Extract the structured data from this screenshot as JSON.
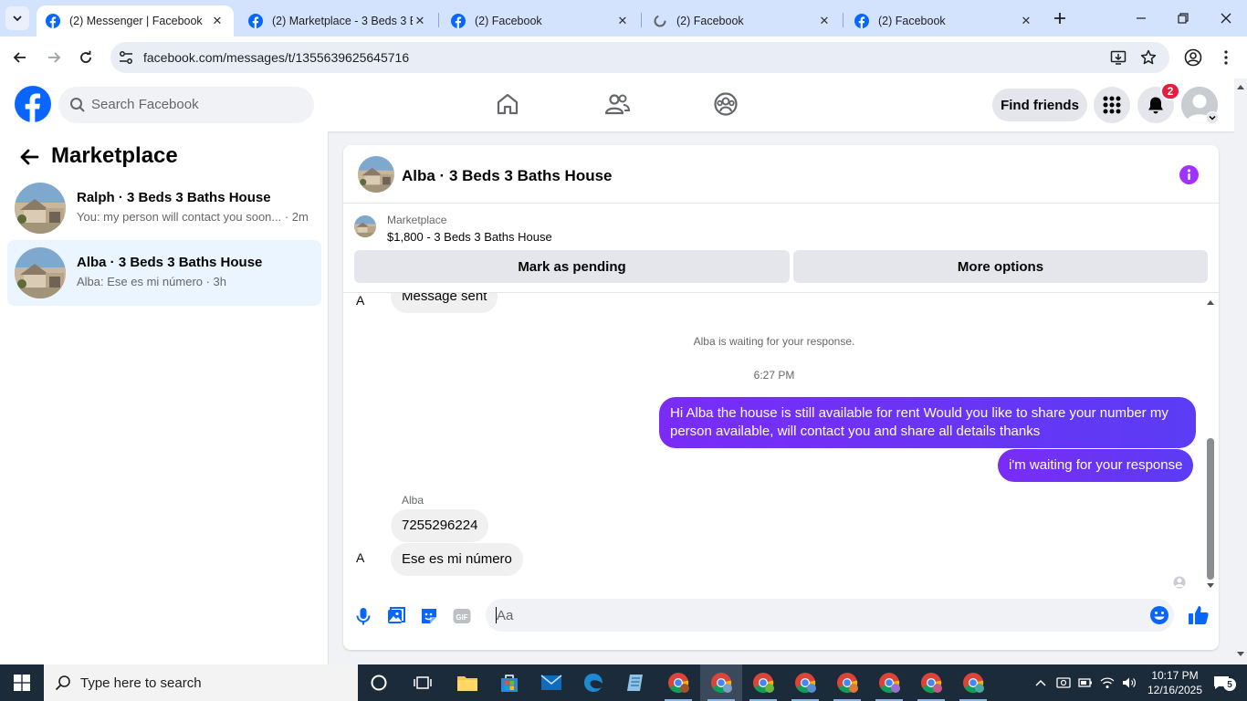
{
  "browser": {
    "tabs": [
      {
        "title": "(2) Messenger | Facebook",
        "active": true
      },
      {
        "title": "(2) Marketplace - 3 Beds 3 B",
        "active": false
      },
      {
        "title": "(2) Facebook",
        "active": false
      },
      {
        "title": "(2) Facebook",
        "active": false
      },
      {
        "title": "(2) Facebook",
        "active": false
      }
    ],
    "url": "facebook.com/messages/t/1355639625645716"
  },
  "fb": {
    "search_placeholder": "Search Facebook",
    "find_friends": "Find friends",
    "notification_count": "2",
    "accent_color": "#0866ff"
  },
  "sidebar": {
    "title": "Marketplace",
    "conversations": [
      {
        "name": "Ralph · 3 Beds 3 Baths House",
        "preview": "You: my person will contact you soon... · 2m",
        "active": false
      },
      {
        "name": "Alba · 3 Beds 3 Baths House",
        "preview": "Alba: Ese es mi número · 3h",
        "active": true
      }
    ]
  },
  "chat": {
    "title": "Alba · 3 Beds 3 Baths House",
    "listing": {
      "category": "Marketplace",
      "price_title": "$1,800 - 3 Beds 3 Baths House",
      "mark_pending": "Mark as pending",
      "more_options": "More options"
    },
    "messages": {
      "partial_top": "Message sent",
      "waiting_notice": "Alba is waiting for your response.",
      "timestamp": "6:27 PM",
      "out_1": "Hi Alba the house is still available for rent Would you like to share your number my person available, will contact you and share all details thanks",
      "out_2": "i'm waiting for your response",
      "sender": "Alba",
      "in_1": "7255296224",
      "in_2": "Ese es mi número",
      "avatar_alt": "A"
    },
    "composer_placeholder": "Aa",
    "outgoing_color": "#6a34f5"
  },
  "taskbar": {
    "search_placeholder": "Type here to search",
    "time": "10:17 PM",
    "date": "12/16/2025",
    "notification_count": "5"
  }
}
